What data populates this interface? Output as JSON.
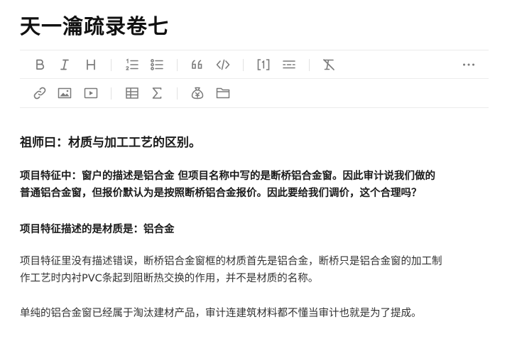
{
  "document": {
    "title": "天一瀹疏录卷七"
  },
  "toolbar": {
    "row1": [
      "bold-icon",
      "italic-icon",
      "heading-icon",
      "ordered-list-icon",
      "bullet-list-icon",
      "quote-icon",
      "code-icon",
      "footnote-icon",
      "divider-icon",
      "clear-format-icon",
      "more-icon"
    ],
    "row2": [
      "link-icon",
      "image-icon",
      "video-icon",
      "table-icon",
      "formula-icon",
      "bounty-icon",
      "folder-icon"
    ]
  },
  "content": {
    "heading_1": "祖师曰：材质与加工工艺的区别。",
    "question_line_1": "项目特征中：窗户的描述是铝合金  但项目名称中写的是断桥铝合金窗。因此审计说我们做的",
    "question_line_2": "普通铝合金窗，但报价默认为是按照断桥铝合金报价。因此要给我们调价，这个合理吗？",
    "heading_2": "项目特征描述的是材质是：铝合金",
    "answer_line_1": "项目特征里没有描述错误，断桥铝合金窗框的材质首先是铝合金，断桥只是铝合金窗的加工制",
    "answer_line_2": "作工艺时内衬PVC条起到阻断热交换的作用，并不是材质的名称。",
    "answer_2": "单纯的铝合金窗已经属于淘汰建材产品，审计连建筑材料都不懂当审计也就是为了提成。"
  }
}
